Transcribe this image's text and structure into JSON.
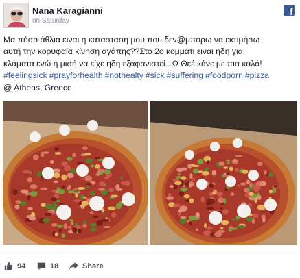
{
  "post": {
    "author": "Nana Karagianni",
    "time": "on Saturday",
    "text_lines": [
      "Μα πόσο άθλια ειναι η κατασταση μου που δεν@μπορω να εκτιμήσω",
      "αυτή την κορυφαία κίνηση αγάπης??Στο 2ο κομμάτι ειναι ηδη για",
      "κλάματα ενώ η μισή να είχε ηδη εξαφανιστεί...Ω Θεέ,κάνε με πια καλά!"
    ],
    "hashtags": [
      "#feelingsick",
      "#prayforhealth",
      "#nothealty",
      "#sick",
      "#suffering",
      "#foodporn",
      "#pizza"
    ],
    "location": "@ Athens, Greece"
  },
  "photos": [
    {
      "icon": "pizza-photo-icon"
    },
    {
      "icon": "pizza-photo-icon"
    }
  ],
  "footer": {
    "likes": "94",
    "comments": "18",
    "share_label": "Share"
  },
  "colors": {
    "brand": "#3b5998",
    "link": "#365899",
    "muted": "#90949c"
  }
}
